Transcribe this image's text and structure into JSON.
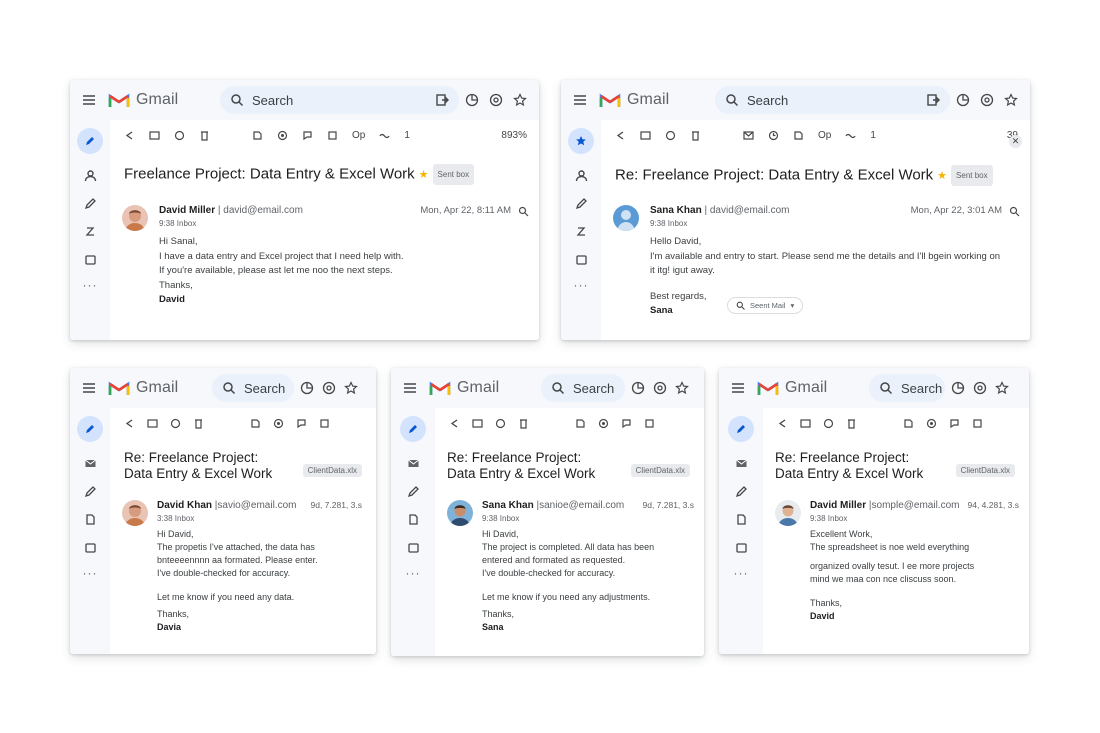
{
  "app": {
    "brand": "Gmail",
    "search_placeholder": "Search"
  },
  "windows": [
    {
      "id": "w1",
      "subject": "Freelance Project: Data Entry & Excel Work",
      "starred": true,
      "label": "Sent box",
      "zoom_pct": "893%",
      "sender_name": "David Miller",
      "sender_email": "| david@email.com",
      "to_line": "9:38 Inbox",
      "date": "Mon, Apr 22, 8:11 AM",
      "avatar": "person",
      "lines": [
        "Hi Sanal,",
        "I have a data entry and Excel project that I need help with.",
        "If you're available, please ast let me noo the next steps.",
        "Thanks,"
      ],
      "signoff": "David"
    },
    {
      "id": "w2",
      "subject": "Re: Freelance Project: Data Entry & Excel Work",
      "starred": true,
      "label": "Sent box",
      "zoom_pct": "39",
      "sender_name": "Sana Khan",
      "sender_email": "| david@email.com",
      "to_line": "9:38 Inbox",
      "date": "Mon, Apr 22, 3:01 AM",
      "avatar": "default",
      "lines": [
        "Hello David,",
        "I'm available and entry to start. Please send me the details and I'll bgein working on",
        "it itg! igut away."
      ],
      "regards": "Best regards,",
      "signoff": "Sana",
      "seen_chip": "Seent Mail"
    },
    {
      "id": "w3",
      "subject_l1": "Re: Freelance Project:",
      "subject_l2": "Data Entry & Excel Work",
      "label": "ClientData.xlx",
      "sender_name": "David Khan",
      "sender_email": "|savio@email.com",
      "to_line": "3:38 Inbox",
      "date": "9d, 7.281, 3.s",
      "avatar": "person",
      "lines": [
        "Hi David,",
        "The propetis I've attached, the data has",
        "bnteeeennnn aa formated. Please enter.",
        "I've double-checked for accuracy."
      ],
      "lines2": [
        "Let me know if you need any data.",
        "Thanks,"
      ],
      "signoff": "Davia"
    },
    {
      "id": "w4",
      "subject_l1": "Re: Freelance Project:",
      "subject_l2": "Data Entry & Excel Work",
      "label": "ClientData.xlx",
      "sender_name": "Sana Khan",
      "sender_email": "|sanioe@email.com",
      "to_line": "9:38 Inbox",
      "date": "9d, 7.281, 3.s",
      "avatar": "person2",
      "lines": [
        "Hi David,",
        "The project is completed. All data has been",
        "entered and formated as requested.",
        "I've double-checked for accuracy."
      ],
      "lines2": [
        "Let me know if you need any adjustments.",
        "Thanks,"
      ],
      "signoff": "Sana"
    },
    {
      "id": "w5",
      "subject_l1": "Re: Freelance Project:",
      "subject_l2": "Data Entry & Excel Work",
      "label": "ClientData.xlx",
      "sender_name": "David Miller",
      "sender_email": "|somple@email.com",
      "to_line": "9:38 Inbox",
      "date": "94, 4.281, 3.s",
      "avatar": "person3",
      "lines": [
        "Excellent Work,",
        "The spreadsheet is noe weld everything"
      ],
      "lines2": [
        "organized ovally tesut. I ee more projects",
        "mind we maa con nce cliscuss soon."
      ],
      "lines3": [
        "Thanks,"
      ],
      "signoff": "David"
    }
  ],
  "colors": {
    "accent": "#0b57d0",
    "star": "#f4b400",
    "bar_bg": "#f6f8fc",
    "search_bg": "#eaf1fb"
  }
}
